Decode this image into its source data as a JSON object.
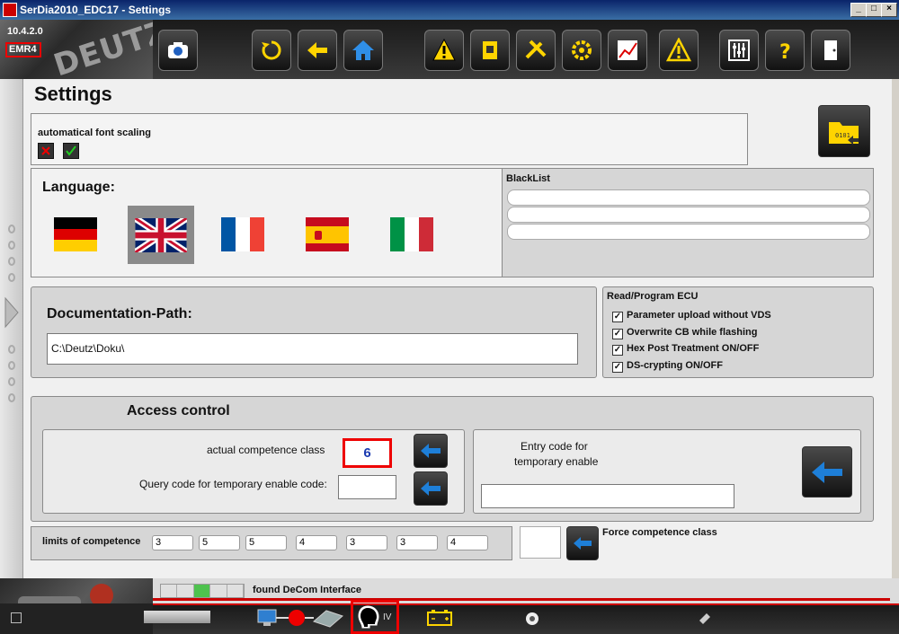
{
  "window": {
    "title": "SerDia2010_EDC17 - Settings",
    "min_label": "_",
    "max_label": "□",
    "close_label": "×"
  },
  "header": {
    "version": "10.4.2.0",
    "module": "EMR4",
    "brand": "DEUTZ"
  },
  "toolbar": {
    "items": [
      "camera-icon",
      "refresh-icon",
      "back-arrow-icon",
      "home-icon",
      "warning-icon",
      "ecu-chip-icon",
      "tools-icon",
      "engine-gear-icon",
      "chart-icon",
      "alert-icon",
      "sliders-icon",
      "help-icon",
      "exit-door-icon"
    ]
  },
  "page": {
    "title": "Settings"
  },
  "font_scaling": {
    "label": "automatical font scaling"
  },
  "language": {
    "label": "Language:",
    "flags": [
      "de",
      "gb",
      "fr",
      "es",
      "it"
    ],
    "selected": "gb"
  },
  "blacklist": {
    "label": "BlackList",
    "rows": [
      "",
      "",
      ""
    ]
  },
  "documentation": {
    "label": "Documentation-Path:",
    "path": "C:\\Deutz\\Doku\\"
  },
  "read_program": {
    "label": "Read/Program ECU",
    "options": [
      {
        "label": "Parameter upload without VDS",
        "checked": true
      },
      {
        "label": "Overwrite CB while flashing",
        "checked": true
      },
      {
        "label": "Hex Post Treatment ON/OFF",
        "checked": true
      },
      {
        "label": "DS-crypting ON/OFF",
        "checked": true
      }
    ]
  },
  "access": {
    "title": "Access control",
    "competence_label": "actual competence class",
    "competence_value": "6",
    "query_label": "Query code for temporary enable code:",
    "query_value": "",
    "entry_label_1": "Entry code for",
    "entry_label_2": "temporary enable",
    "entry_value": ""
  },
  "limits": {
    "label": "limits of competence",
    "values": [
      "3",
      "5",
      "5",
      "4",
      "3",
      "3",
      "4"
    ],
    "force_label": "Force competence class",
    "force_value": ""
  },
  "status": {
    "found_text": "found DeCom Interface",
    "mode": "IV",
    "progress_segments": 5,
    "progress_on_index": 2
  },
  "colors": {
    "accent_red": "#e00000",
    "toolbar_yellow": "#ffd400",
    "arrow_blue": "#1e7fd8"
  }
}
